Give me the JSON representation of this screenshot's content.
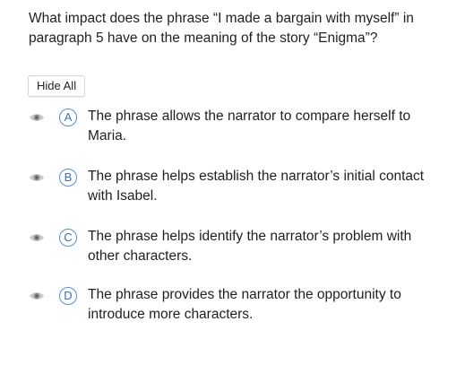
{
  "question": {
    "text": "What impact does the phrase “I made a bargain with myself” in paragraph 5 have on the meaning of the story “Enigma”?"
  },
  "controls": {
    "hide_all_label": "Hide All"
  },
  "colors": {
    "accent": "#3a6fb0",
    "eye_icon": "#9a9a9a"
  },
  "options": [
    {
      "letter": "A",
      "text": "The phrase allows the narrator to compare herself to Maria.",
      "icon": "eye-icon"
    },
    {
      "letter": "B",
      "text": "The phrase helps establish the narrator’s initial contact with Isabel.",
      "icon": "eye-icon"
    },
    {
      "letter": "C",
      "text": "The phrase helps identify the narrator’s problem with other characters.",
      "icon": "eye-icon"
    },
    {
      "letter": "D",
      "text": "The phrase provides the narrator the opportunity to introduce more characters.",
      "icon": "eye-icon"
    }
  ]
}
